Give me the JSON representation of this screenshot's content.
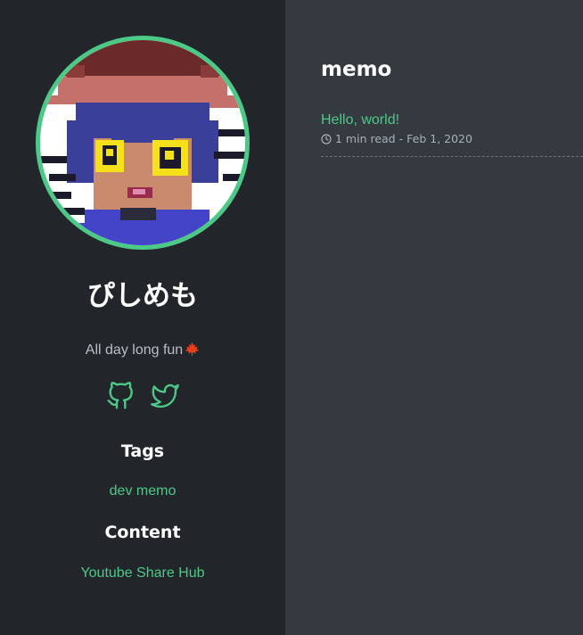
{
  "sidebar": {
    "site_title": "ぴしめも",
    "tagline": "All day long fun",
    "social": [
      {
        "name": "github",
        "icon": "github-icon"
      },
      {
        "name": "twitter",
        "icon": "twitter-icon"
      }
    ],
    "tags_heading": "Tags",
    "tags": [
      "dev",
      "memo"
    ],
    "content_heading": "Content",
    "content_links": [
      "Youtube Share Hub"
    ],
    "avatar_icon": "pixel-art-avatar",
    "tagline_icon": "maple-leaf-icon"
  },
  "main": {
    "heading": "memo",
    "posts": [
      {
        "title": "Hello, world!",
        "read_time": "1 min read",
        "separator": "-",
        "date": "Feb 1, 2020"
      }
    ]
  },
  "colors": {
    "sidebar_bg": "#22262b",
    "main_bg": "#353a41",
    "accent": "#4cc987",
    "text": "#ffffff",
    "muted": "#b9bec5",
    "leaf": "#e8401c"
  }
}
